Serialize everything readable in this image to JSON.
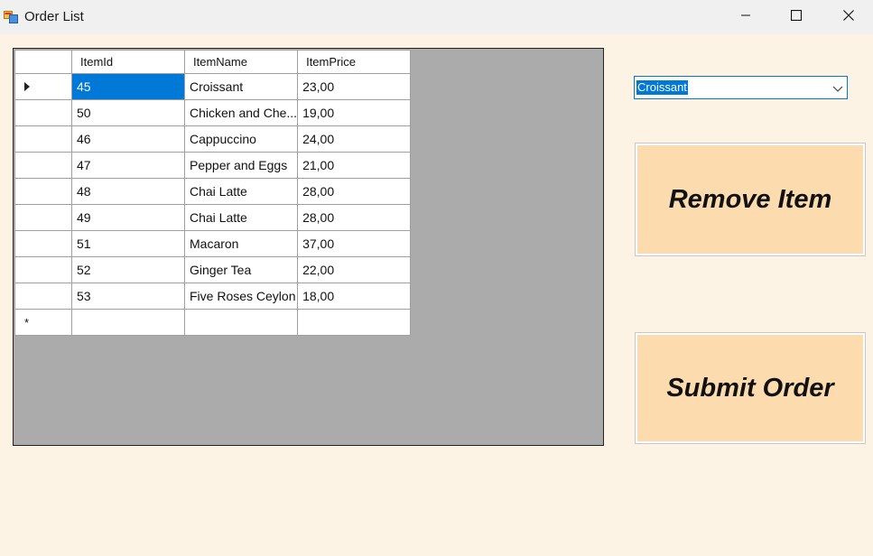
{
  "window": {
    "title": "Order List"
  },
  "grid": {
    "columns": [
      "ItemId",
      "ItemName",
      "ItemPrice"
    ],
    "rows": [
      [
        "45",
        "Croissant",
        "23,00"
      ],
      [
        "50",
        "Chicken and Che...",
        "19,00"
      ],
      [
        "46",
        "Cappuccino",
        "24,00"
      ],
      [
        "47",
        "Pepper and Eggs",
        "21,00"
      ],
      [
        "48",
        "Chai Latte",
        "28,00"
      ],
      [
        "49",
        "Chai Latte",
        "28,00"
      ],
      [
        "51",
        "Macaron",
        "37,00"
      ],
      [
        "52",
        "Ginger Tea",
        "22,00"
      ],
      [
        "53",
        "Five Roses Ceylon",
        "18,00"
      ]
    ],
    "new_row_marker": "*"
  },
  "item_select": {
    "value": "Croissant"
  },
  "buttons": {
    "remove": "Remove Item",
    "submit": "Submit Order"
  },
  "icons": {
    "app": "form-icon",
    "minimize": "minimize-icon",
    "maximize": "maximize-icon",
    "close": "close-icon",
    "current_row": "row-pointer-icon",
    "dropdown": "chevron-down-icon"
  }
}
